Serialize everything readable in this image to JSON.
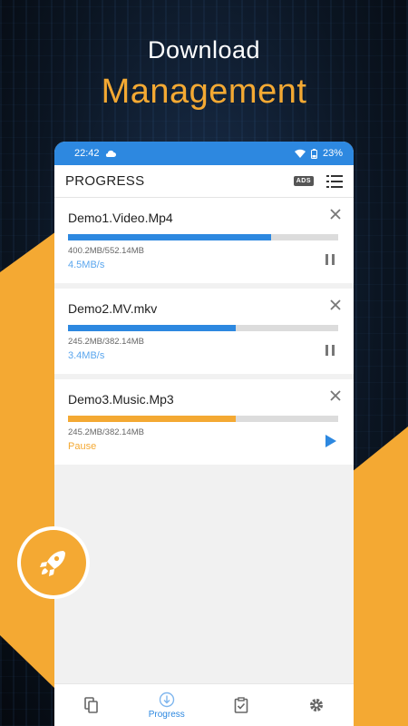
{
  "headline": {
    "line1": "Download",
    "line2": "Management"
  },
  "status": {
    "time": "22:42",
    "battery": "23%"
  },
  "appbar": {
    "title": "PROGRESS",
    "ads": "ADS"
  },
  "downloads": [
    {
      "name": "Demo1.Video.Mp4",
      "size": "400.2MB/552.14MB",
      "status": "4.5MB/s",
      "progress": 0.75,
      "state": "downloading",
      "color": "#2d88e0"
    },
    {
      "name": "Demo2.MV.mkv",
      "size": "245.2MB/382.14MB",
      "status": "3.4MB/s",
      "progress": 0.62,
      "state": "downloading",
      "color": "#2d88e0"
    },
    {
      "name": "Demo3.Music.Mp3",
      "size": "245.2MB/382.14MB",
      "status": "Pause",
      "progress": 0.62,
      "state": "paused",
      "color": "#f4a933"
    }
  ],
  "nav": {
    "active_label": "Progress"
  },
  "colors": {
    "accent": "#2d88e0",
    "orange": "#f4a933"
  }
}
